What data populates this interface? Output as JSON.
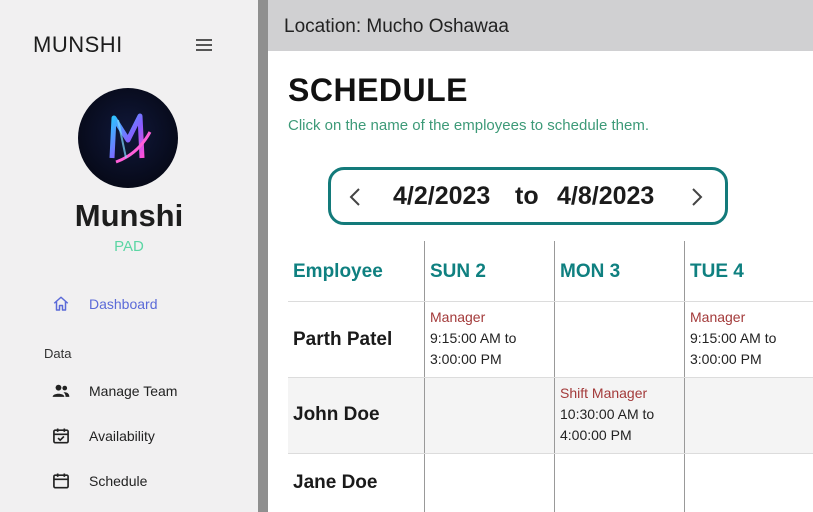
{
  "sidebar": {
    "brand": "MUNSHI",
    "profile": {
      "name": "Munshi",
      "role": "PAD"
    },
    "nav": {
      "dashboard": "Dashboard",
      "section_label": "Data",
      "manage_team": "Manage Team",
      "availability": "Availability",
      "schedule": "Schedule"
    }
  },
  "topbar": {
    "location": "Location: Mucho Oshawaa"
  },
  "main": {
    "title": "SCHEDULE",
    "subtitle": "Click on the name of the employees to schedule them.",
    "date_range": {
      "start": "4/2/2023",
      "separator": "to",
      "end": "4/8/2023"
    },
    "table": {
      "headers": [
        "Employee",
        "SUN 2",
        "MON 3",
        "TUE 4"
      ],
      "rows": [
        {
          "name": "Parth Patel",
          "shifts": [
            {
              "role": "Manager",
              "line1": "9:15:00 AM to",
              "line2": "3:00:00 PM"
            },
            {
              "role": "",
              "line1": "",
              "line2": ""
            },
            {
              "role": "Manager",
              "line1": "9:15:00 AM to",
              "line2": "3:00:00 PM"
            }
          ]
        },
        {
          "name": "John Doe",
          "shifts": [
            {
              "role": "",
              "line1": "",
              "line2": ""
            },
            {
              "role": "Shift Manager",
              "line1": "10:30:00 AM to",
              "line2": "4:00:00 PM"
            },
            {
              "role": "",
              "line1": "",
              "line2": ""
            }
          ]
        },
        {
          "name": "Jane Doe",
          "shifts": [
            {
              "role": "",
              "line1": "",
              "line2": ""
            },
            {
              "role": "",
              "line1": "",
              "line2": ""
            },
            {
              "role": "",
              "line1": "",
              "line2": ""
            }
          ]
        }
      ]
    }
  },
  "colors": {
    "accent_teal": "#137a7a",
    "header_teal": "#0f8080",
    "active_nav": "#5b6ad8",
    "role_red": "#a33a3a",
    "subtitle_green": "#3d9a78"
  },
  "icons": [
    "menu-icon",
    "home-icon",
    "people-icon",
    "calendar-check-icon",
    "calendar-icon",
    "chevron-left-icon",
    "chevron-right-icon"
  ]
}
